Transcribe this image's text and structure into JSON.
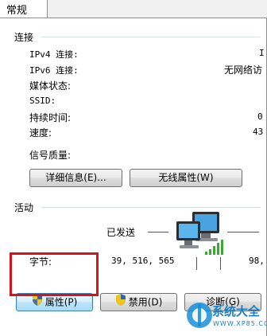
{
  "tabs": [
    {
      "label": "常规"
    }
  ],
  "connection": {
    "group_title": "连接",
    "rows": [
      {
        "label": "IPv4 连接:",
        "value": "I"
      },
      {
        "label": "IPv6 连接:",
        "value": "无网络访"
      },
      {
        "label": "媒体状态:",
        "value": ""
      },
      {
        "label": "SSID:",
        "value": ""
      },
      {
        "label": "持续时间:",
        "value": "0"
      },
      {
        "label": "速度:",
        "value": "43"
      }
    ],
    "signal_label": "信号质量:",
    "details_button": "详细信息(E)...",
    "wireless_button": "无线属性(W)"
  },
  "activity": {
    "group_title": "活动",
    "sent_label": "已发送",
    "bytes_label": "字节:",
    "bytes_sent": "39, 516, 565",
    "bytes_received": "98,"
  },
  "buttons": {
    "properties": "属性(P)",
    "disable": "禁用(D)",
    "diagnose": "诊断(G)"
  },
  "watermark": {
    "text": "系统大全",
    "url": "WWW.XP85.COM"
  }
}
